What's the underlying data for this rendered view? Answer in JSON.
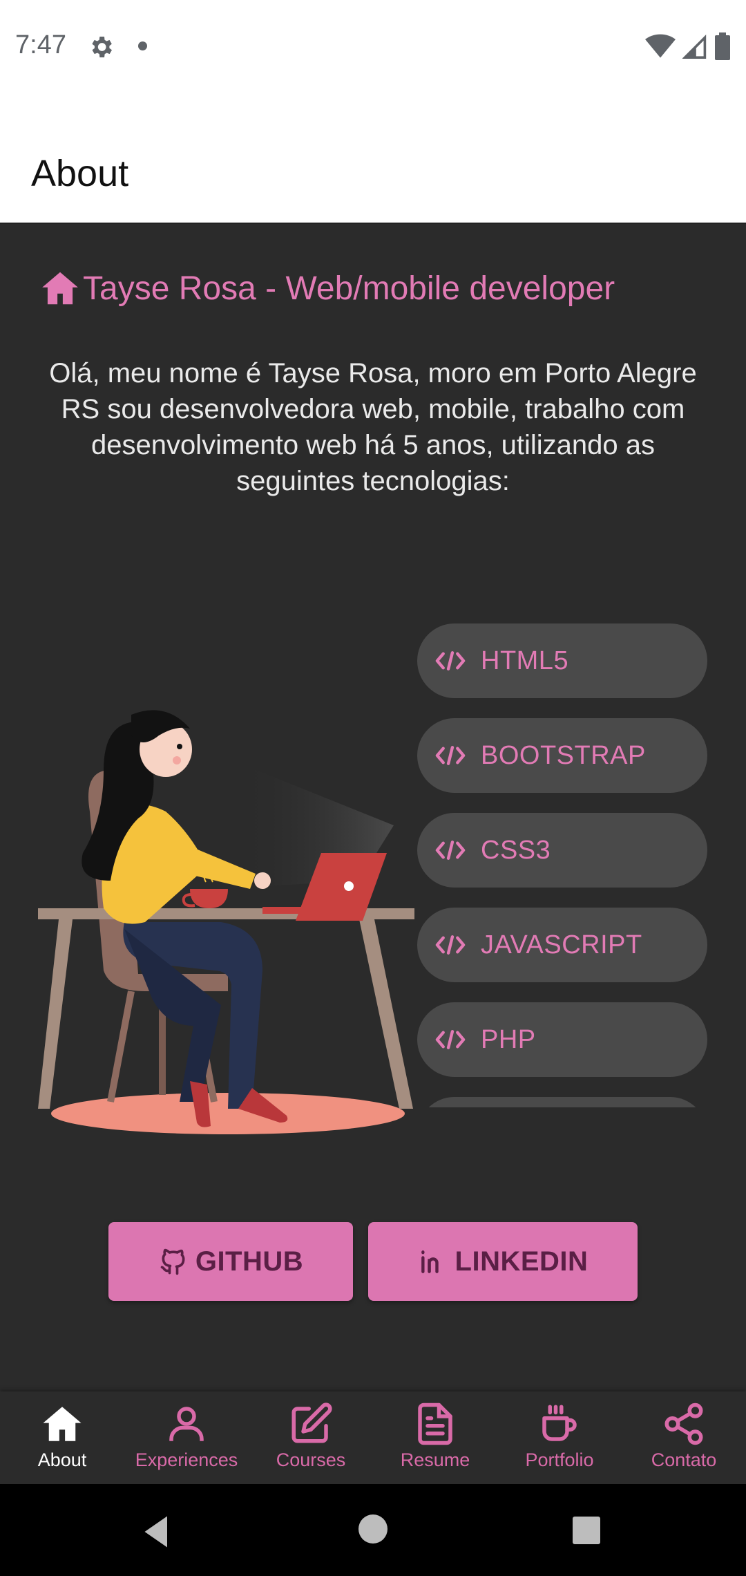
{
  "status_bar": {
    "time": "7:47",
    "icons": [
      "gear-icon",
      "notification-dot",
      "wifi-icon",
      "signal-icon",
      "battery-icon"
    ]
  },
  "app_bar": {
    "title": "About"
  },
  "colors": {
    "accent": "#e27bb5",
    "button": "#dc76b1",
    "background": "#2b2b2b",
    "pill": "#4a4a4a"
  },
  "main": {
    "heading": "Tayse Rosa - Web/mobile developer",
    "heading_icon": "home-icon",
    "intro": "Olá, meu nome é Tayse Rosa, moro em Porto Alegre RS sou desenvolvedora web, mobile, trabalho com desenvolvimento web há 5 anos, utilizando as seguintes tecnologias:",
    "skills": [
      {
        "label": "HTML5",
        "icon": "code-icon"
      },
      {
        "label": "BOOTSTRAP",
        "icon": "code-icon"
      },
      {
        "label": "CSS3",
        "icon": "code-icon"
      },
      {
        "label": "JAVASCRIPT",
        "icon": "code-icon"
      },
      {
        "label": "PHP",
        "icon": "code-icon"
      }
    ],
    "buttons": {
      "github": {
        "label": "GITHUB",
        "icon": "github-icon"
      },
      "linkedin": {
        "label": "LINKEDIN",
        "icon": "linkedin-icon"
      }
    }
  },
  "bottom_nav": {
    "items": [
      {
        "label": "About",
        "icon": "home-icon",
        "active": true
      },
      {
        "label": "Experiences",
        "icon": "person-icon",
        "active": false
      },
      {
        "label": "Courses",
        "icon": "edit-icon",
        "active": false
      },
      {
        "label": "Resume",
        "icon": "document-icon",
        "active": false
      },
      {
        "label": "Portfolio",
        "icon": "coffee-icon",
        "active": false
      },
      {
        "label": "Contato",
        "icon": "share-icon",
        "active": false
      }
    ]
  }
}
